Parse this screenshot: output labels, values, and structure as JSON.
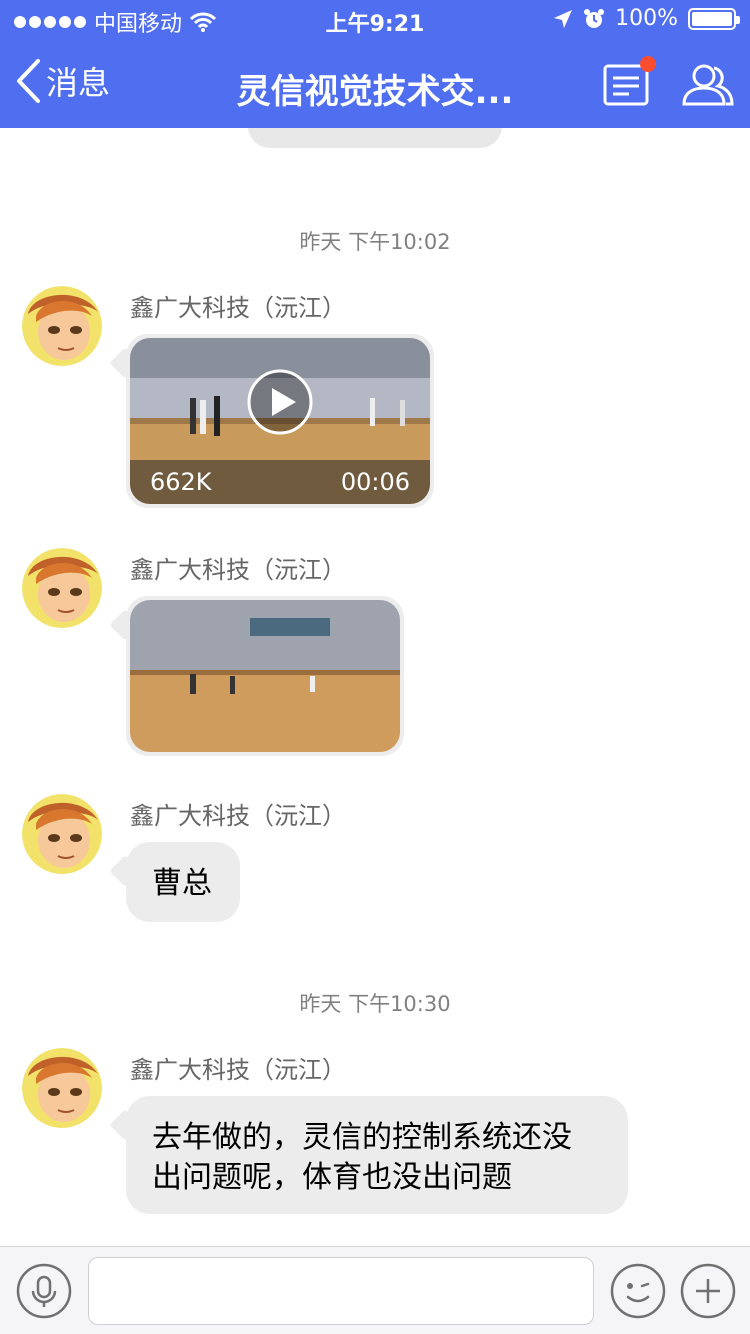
{
  "status_bar": {
    "carrier": "中国移动",
    "time": "上午9:21",
    "battery": "100%"
  },
  "nav": {
    "back_label": "消息",
    "title": "灵信视觉技术交..."
  },
  "messages": [
    {
      "type": "timestamp",
      "text": "昨天 下午10:02"
    },
    {
      "type": "video",
      "sender": "鑫广大科技（沅江）",
      "size": "662K",
      "duration": "00:06"
    },
    {
      "type": "image",
      "sender": "鑫广大科技（沅江）"
    },
    {
      "type": "text",
      "sender": "鑫广大科技（沅江）",
      "text": "曹总"
    },
    {
      "type": "timestamp",
      "text": "昨天 下午10:30"
    },
    {
      "type": "text",
      "sender": "鑫广大科技（沅江）",
      "lines": [
        "去年做的，灵信的控制系统还没",
        "出问题呢，体育也没出问题"
      ]
    }
  ],
  "input": {
    "placeholder": ""
  },
  "colors": {
    "header": "#4f6ef0",
    "bubble": "#ececec",
    "notice_dot": "#ff4e2f"
  },
  "icons": [
    "signal-icon",
    "wifi-icon",
    "location-arrow-icon",
    "alarm-icon",
    "battery-icon",
    "back-chevron-icon",
    "notice-board-icon",
    "group-members-icon",
    "play-icon",
    "microphone-icon",
    "emoji-icon",
    "plus-icon"
  ]
}
